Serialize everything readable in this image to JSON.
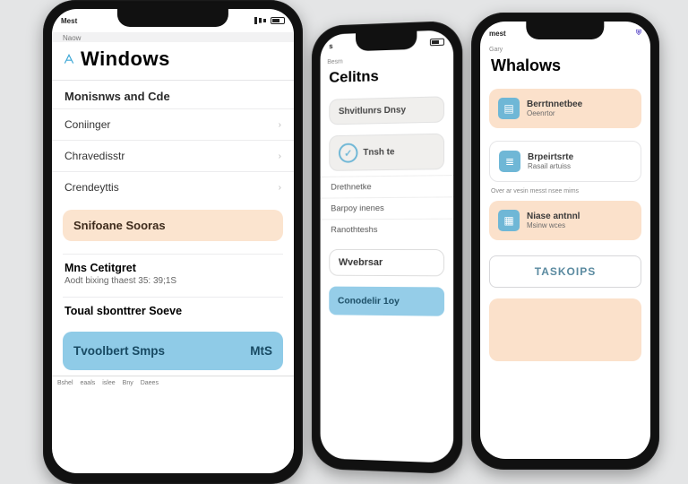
{
  "phoneA": {
    "status_left": "Mest",
    "mini": "Naow",
    "title": "Windows",
    "section1": "Monisnws and Cde",
    "rows": [
      "Coniinger",
      "Chravedisstr",
      "Crendeyttis"
    ],
    "card_peach": "Snifoane Sooras",
    "block_title": "Mns Cetitgret",
    "block_sub": "Aodt bixing thaest 35: 39;1S",
    "block2_title": "Toual sbonttrer Soeve",
    "btn_label": "Tvoolbert Smps",
    "btn_right": "MtS",
    "foot": [
      "Bshel",
      "eaals",
      "islee",
      "Bny",
      "Daees"
    ]
  },
  "phoneB": {
    "status_left": "s",
    "mini": "Besm",
    "title": "Celitns",
    "card1": "Shvitlunrs Dnsy",
    "ring_label": "Tnsh te",
    "lines": [
      "Drethnetke",
      "Barpoy inenes",
      "Ranothteshs"
    ],
    "label_box": "Wvebrsar",
    "btn": "Conodelir 1oy"
  },
  "phoneC": {
    "status_left": "mest",
    "mini": "Gary",
    "title": "Whalows",
    "items": [
      {
        "t1": "Berrtnnetbee",
        "t2": "Oeenrtor"
      },
      {
        "t1": "Brpeirtsrte",
        "t2": "Rasail artuiss"
      },
      {
        "t1": "Niase antnnl",
        "t2": "Msinw wces"
      }
    ],
    "note": "Over ar  vesin messt nsee mims",
    "tab": "TASKOIPS"
  }
}
